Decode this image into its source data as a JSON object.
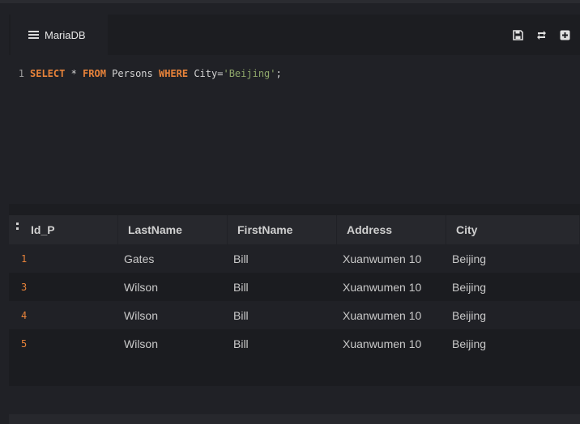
{
  "tab": {
    "label": "MariaDB",
    "icon": "database-icon"
  },
  "toolbar": {
    "icons": [
      "save-icon",
      "refresh-icon",
      "add-icon"
    ]
  },
  "editor": {
    "line_number": "1",
    "tokens": {
      "select": "SELECT",
      "star": " * ",
      "from": "FROM",
      "table": " Persons ",
      "where": "WHERE",
      "cond": " City=",
      "value": "'Beijing'",
      "end": ";"
    }
  },
  "grid": {
    "columns": [
      "Id_P",
      "LastName",
      "FirstName",
      "Address",
      "City"
    ],
    "rows": [
      {
        "id": "1",
        "last": "Gates",
        "first": "Bill",
        "address": "Xuanwumen 10",
        "city": "Beijing"
      },
      {
        "id": "3",
        "last": "Wilson",
        "first": "Bill",
        "address": "Xuanwumen 10",
        "city": "Beijing"
      },
      {
        "id": "4",
        "last": "Wilson",
        "first": "Bill",
        "address": "Xuanwumen 10",
        "city": "Beijing"
      },
      {
        "id": "5",
        "last": "Wilson",
        "first": "Bill",
        "address": "Xuanwumen 10",
        "city": "Beijing"
      }
    ]
  },
  "colors": {
    "keyword": "#e8833a",
    "string": "#8ea66a",
    "background": "#202126"
  }
}
